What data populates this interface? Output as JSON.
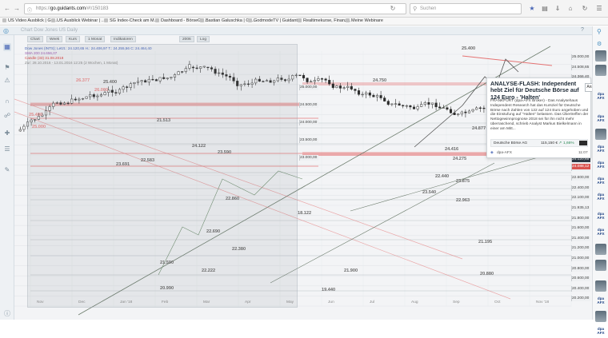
{
  "browser": {
    "url_prefix": "https://",
    "url_host": "go.guidants.com",
    "url_path": "/#!/150183",
    "search_placeholder": "Suchen",
    "bookmarks": [
      "US Video Ausblick | Gu...",
      "US Ausblick Webinar | ...",
      "SG Index-Check am M...",
      "Dashboard - BörseGo ...",
      "Bastian Galuschka | Gu...",
      "GodmodeTV | Guidants",
      "Realtimekurse, Finanz...",
      "Meine Webinare"
    ]
  },
  "app": {
    "chart_title": "Chart Dow Jones US Daily"
  },
  "toolbar": {
    "buttons": [
      "Chart",
      "Week",
      "Kurs",
      "1 Monat",
      "Indikatoren",
      "2006",
      "Log"
    ]
  },
  "legend": {
    "lines": [
      "Dow Jones (INTS); Letzt.: 24.120,65  H.: 24.406,97  T.: 24.255,56  C: 24.464,40",
      "SMA 200 24.656,07",
      "Candle (33) 31.08.2018",
      "Zur: 28.10.2016 - 13.01.2016 12:25 (2 Wochen, 1 Monat)"
    ],
    "colors": [
      "#4a67b6",
      "#9b5fb0",
      "#d04848",
      "#888888"
    ]
  },
  "chart_levels": {
    "left_labels": [
      "25.400",
      "26.377",
      "26.000",
      "25.400",
      "25.000",
      "24.122",
      "23.691",
      "22.583",
      "23.590",
      "22.860",
      "22.690",
      "22.222",
      "22.380",
      "21.513",
      "20.990",
      "21.590",
      "18.122"
    ],
    "right_labels": [
      "25.400",
      "24.750",
      "24.877",
      "24.416",
      "24.275",
      "23.540",
      "23.875",
      "22.963",
      "22.440",
      "21.900",
      "21.195",
      "20.880",
      "19.440"
    ],
    "axis_tags": [
      "25.000,00",
      "24.508,65",
      "24.366,40",
      "24.183,33",
      "24.000,00",
      "23.927,71",
      "23.755,08",
      "23.600,00",
      "23.400,00",
      "23.200,00",
      "23.000,00",
      "22.800,00",
      "22.600,00",
      "22.400,00",
      "22.100,00",
      "21.935,13",
      "21.800,00",
      "21.600,00",
      "21.400,00",
      "21.200,00",
      "21.000,00",
      "20.800,00",
      "20.600,00",
      "20.400,00",
      "20.200,00"
    ],
    "highlight_tags": [
      "24.120,65",
      "24.088,12",
      "23.861,07"
    ],
    "x_labels": [
      "Nov",
      "Dec",
      "Jan '18",
      "Feb",
      "Mar",
      "Apr",
      "May",
      "Jun",
      "Jul",
      "Aug",
      "Sep",
      "Oct",
      "Nov '18"
    ]
  },
  "news": {
    "title": "ANALYSE-FLASH: Independent hebt Ziel für Deutsche Börse auf 124 Euro - 'Halten'",
    "body": "FRANKFURT (dpa-AFX Broker) - Das Analysehaus Independent Research hat das Kursziel für Deutsche Börse nach Zahlen von 122 auf 124 Euro angehoben und die Einstufung auf \"Halten\" belassen. Das Übertreffen der Nettogewinnprognose 2018 sei für ihn nicht mehr überraschend, schrieb Analyst Markus Bielkelmann in einer am Mitt...",
    "ticker_name": "Deutsche Börse AG",
    "ticker_price": "115,150 €",
    "ticker_change": "1,66%",
    "source": "dpa-AFX",
    "time": "11:07",
    "ansicht_label": "Ansicht [a]"
  },
  "colors": {
    "up": "#5a8a5a",
    "down": "#2b2b2b",
    "support_red": "#e57373",
    "trend_line": "#6b7b6b",
    "accent_blue": "#4a67b6"
  }
}
